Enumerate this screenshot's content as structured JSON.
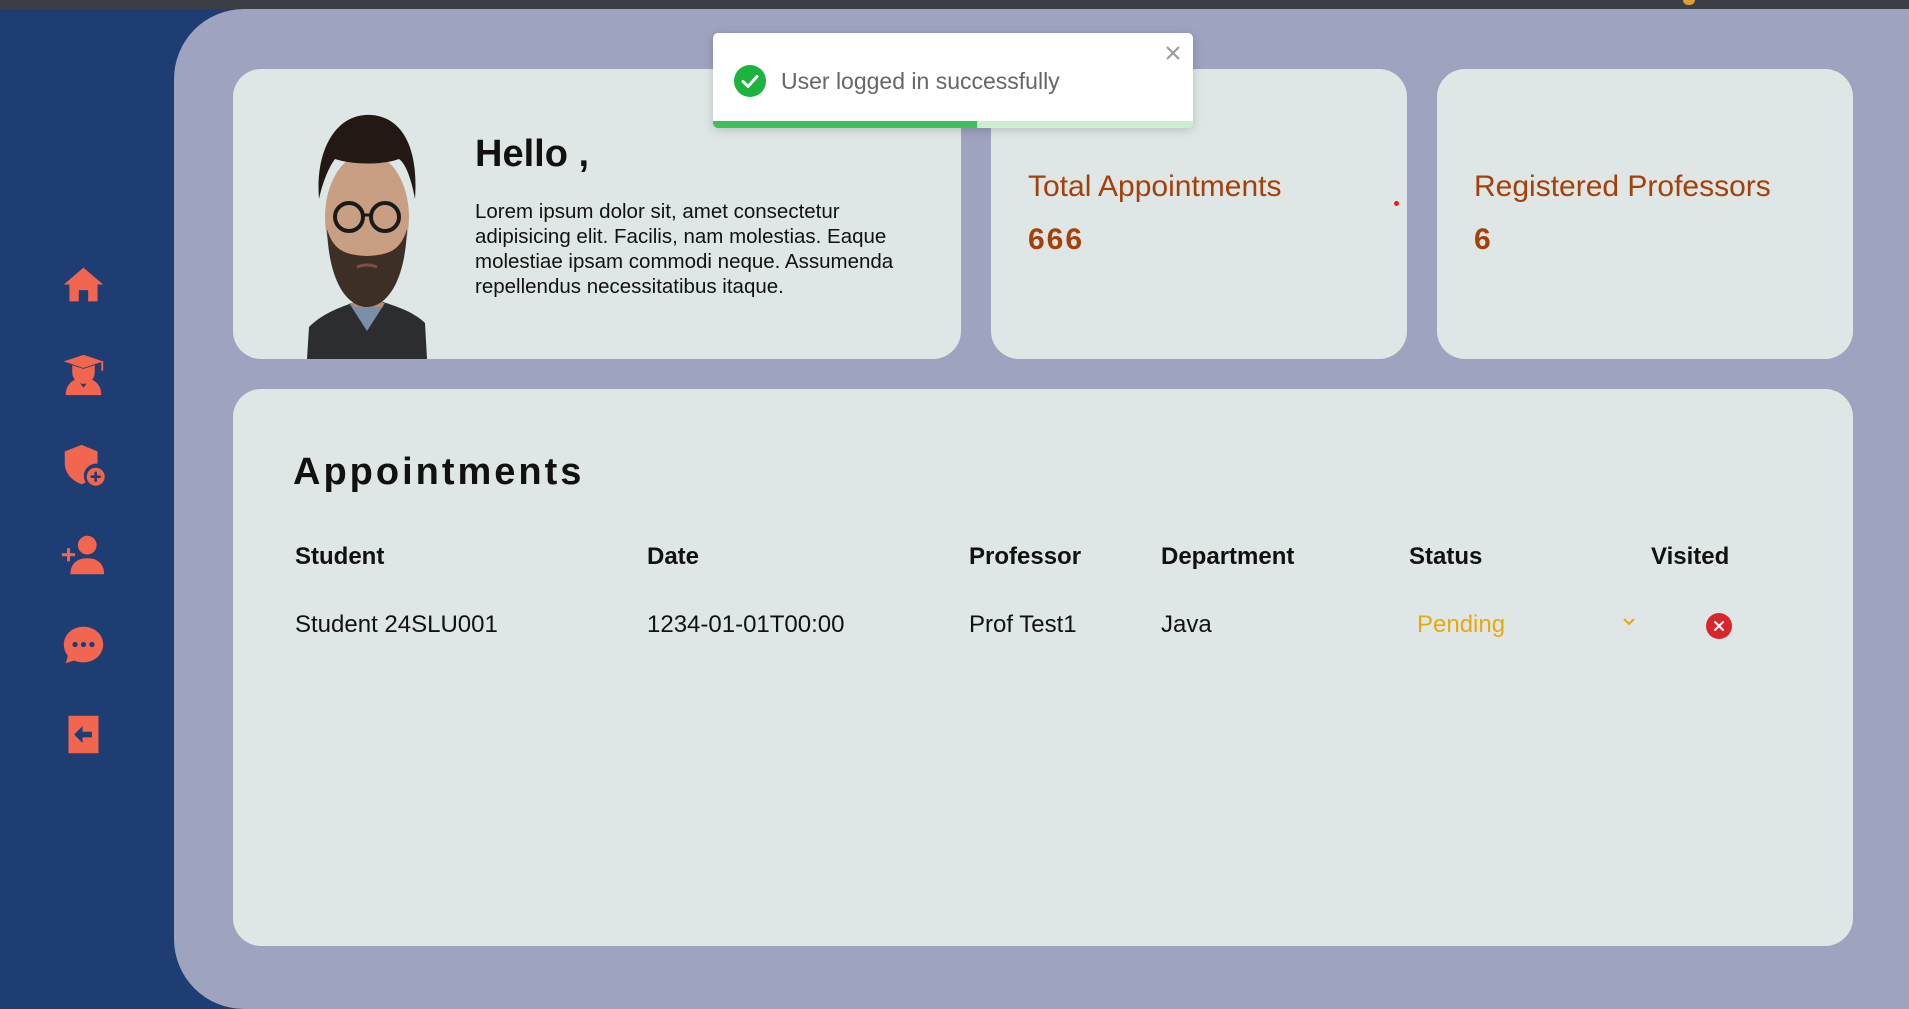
{
  "sidebar": {
    "items": [
      {
        "icon": "home-icon"
      },
      {
        "icon": "graduate-icon"
      },
      {
        "icon": "shield-plus-icon"
      },
      {
        "icon": "add-user-icon"
      },
      {
        "icon": "chat-icon"
      },
      {
        "icon": "logout-icon"
      }
    ]
  },
  "hello": {
    "title": "Hello ,",
    "text": "Lorem ipsum dolor sit, amet consectetur adipisicing elit. Facilis, nam molestias. Eaque molestiae ipsam commodi neque. Assumenda repellendus necessitatibus itaque."
  },
  "stats": {
    "appointments_label": "Total Appointments",
    "appointments_value": "666",
    "professors_label": "Registered Professors",
    "professors_value": "6"
  },
  "appointments": {
    "title": "Appointments",
    "columns": [
      "Student",
      "Date",
      "Professor",
      "Department",
      "Status",
      "Visited"
    ],
    "rows": [
      {
        "student": "Student 24SLU001",
        "date": "1234-01-01T00:00",
        "professor": "Prof Test1",
        "department": "Java",
        "status": "Pending",
        "visited": false
      }
    ]
  },
  "toast": {
    "message": "User logged in successfully",
    "progress": 0.55
  },
  "colors": {
    "sidebar_bg": "#1e3e73",
    "icon": "#f2654f",
    "accent_text": "#a4400a",
    "pending": "#e6a90f",
    "success": "#3cc159",
    "danger": "#d9262c"
  }
}
